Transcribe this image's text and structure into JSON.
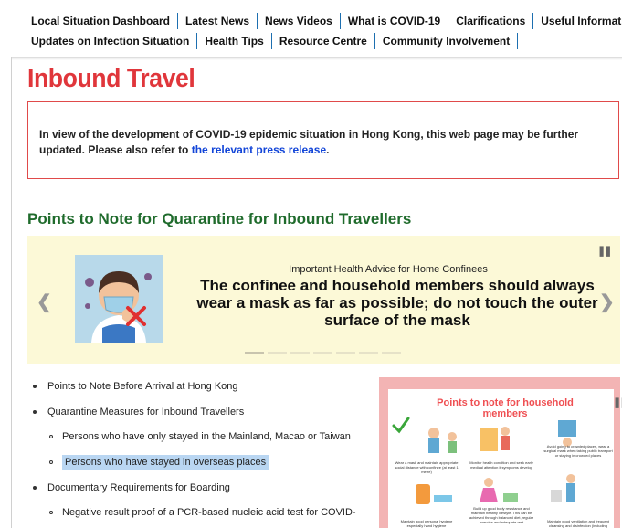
{
  "nav": {
    "row1": [
      "Local Situation Dashboard",
      "Latest News",
      "News Videos",
      "What is COVID-19",
      "Clarifications",
      "Useful Information"
    ],
    "row2": [
      "Updates on Infection Situation",
      "Health Tips",
      "Resource Centre",
      "Community Involvement"
    ]
  },
  "page": {
    "title": "Inbound Travel"
  },
  "notice": {
    "text": "In view of the development of COVID-19 epidemic situation in Hong Kong, this web page may be further updated. Please also refer to ",
    "link": "the relevant press release",
    "end": "."
  },
  "section": {
    "title": "Points to Note for Quarantine for Inbound Travellers"
  },
  "carousel": {
    "subtitle": "Important Health Advice for Home Confinees",
    "headline": "The confinee and household members should always wear a mask as far as possible; do not touch the outer surface of the mask",
    "slide_count": 7,
    "active_slide": 1
  },
  "list": {
    "items": [
      "Points to Note Before Arrival at Hong Kong",
      "Quarantine Measures for Inbound Travellers",
      "Persons who have only stayed in the Mainland, Macao or Taiwan",
      "Persons who have stayed in overseas places",
      "Documentary Requirements for Boarding",
      "Negative result proof of a PCR-based nucleic acid test for COVID-"
    ]
  },
  "poster": {
    "title": "Points to note for household members",
    "tips": [
      "Wear a mask and maintain appropriate social distance with confinee (at least 1 metre)",
      "Monitor health condition and seek early medical attention if symptoms develop",
      "Avoid going to crowded places, wear a surgical mask when taking public transport or staying in crowded places",
      "Maintain good personal hygiene especially hand hygiene",
      "Build up good body resistance and maintain healthy lifestyle. This can be achieved through balanced diet, regular exercise and adequate rest",
      "Maintain good ventilation and frequent cleansing and disinfection (including kitchen and toilet)"
    ]
  },
  "colors": {
    "title_red": "#e0363b",
    "section_green": "#1f6b2c",
    "link_blue": "#1245d8",
    "carousel_bg": "#fcf9d7"
  }
}
